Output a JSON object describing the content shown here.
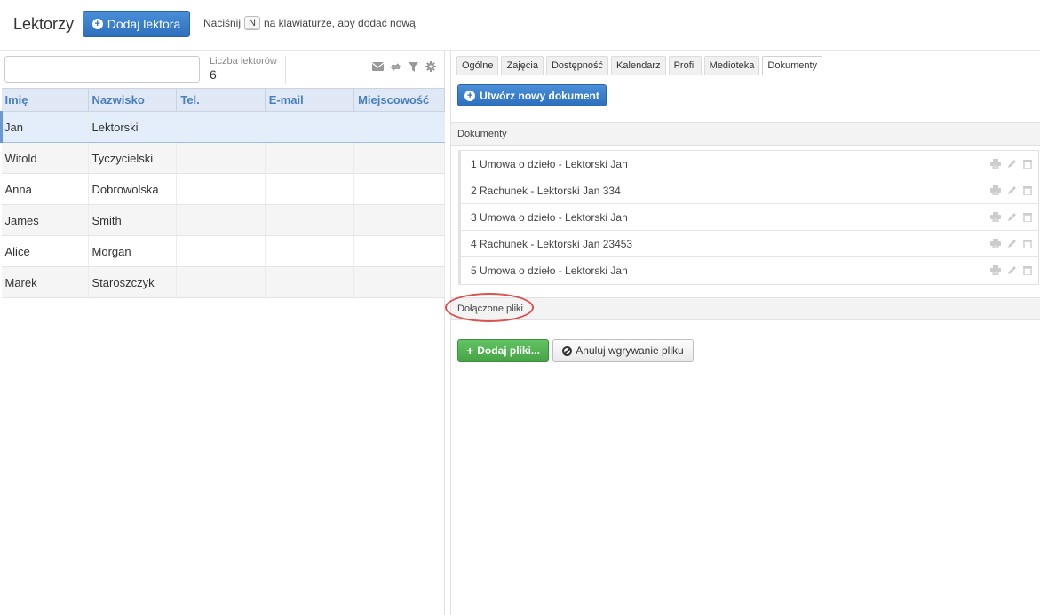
{
  "header": {
    "title": "Lektorzy",
    "add_button": "Dodaj lektora",
    "hint_before": "Naciśnij",
    "hint_key": "N",
    "hint_after": "na klawiaturze, aby dodać nową"
  },
  "list": {
    "search_value": "",
    "count_label": "Liczba lektorów",
    "count_value": "6",
    "tools": [
      "envelope-icon",
      "refresh-icon",
      "filter-icon",
      "gear-icon"
    ],
    "columns": [
      "Imię",
      "Nazwisko",
      "Tel.",
      "E-mail",
      "Miejscowość"
    ],
    "rows": [
      {
        "imie": "Jan",
        "nazwisko": "Lektorski",
        "tel": "",
        "email": "",
        "miasto": ""
      },
      {
        "imie": "Witold",
        "nazwisko": "Tyczycielski",
        "tel": "",
        "email": "",
        "miasto": ""
      },
      {
        "imie": "Anna",
        "nazwisko": "Dobrowolska",
        "tel": "",
        "email": "",
        "miasto": ""
      },
      {
        "imie": "James",
        "nazwisko": "Smith",
        "tel": "",
        "email": "",
        "miasto": ""
      },
      {
        "imie": "Alice",
        "nazwisko": "Morgan",
        "tel": "",
        "email": "",
        "miasto": ""
      },
      {
        "imie": "Marek",
        "nazwisko": "Staroszczyk",
        "tel": "",
        "email": "",
        "miasto": ""
      }
    ]
  },
  "detail": {
    "tabs": [
      "Ogólne",
      "Zajęcia",
      "Dostępność",
      "Kalendarz",
      "Profil",
      "Medioteka",
      "Dokumenty"
    ],
    "active_tab": "Dokumenty",
    "new_doc_button": "Utwórz nowy dokument",
    "docs_section": "Dokumenty",
    "documents": [
      "1 Umowa o dzieło - Lektorski Jan",
      "2 Rachunek - Lektorski Jan 334",
      "3 Umowa o dzieło - Lektorski Jan",
      "4 Rachunek - Lektorski Jan 23453",
      "5 Umowa o dzieło - Lektorski Jan"
    ],
    "doc_actions": [
      "print-icon",
      "edit-icon",
      "trash-icon"
    ],
    "files_section": "Dołączone pliki",
    "add_files_button": "Dodaj pliki...",
    "cancel_upload_button": "Anuluj wgrywanie pliku"
  },
  "colors": {
    "primary": "#2d6fbd",
    "success": "#47a447",
    "header_blue": "#4a7fbf",
    "highlight": "#d9534f"
  }
}
